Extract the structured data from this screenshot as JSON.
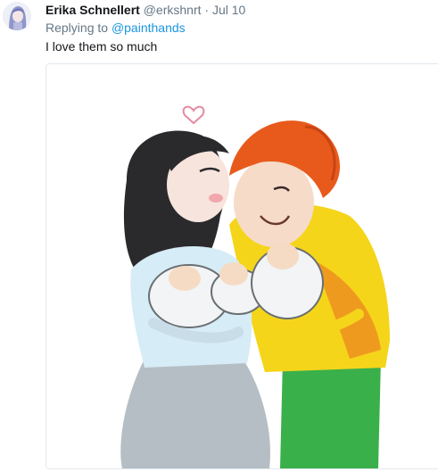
{
  "tweet": {
    "author_name": "Erika Schnellert",
    "handle": "@erkshnrt",
    "separator": "·",
    "date": "Jul 10",
    "replying_prefix": "Replying to",
    "replying_to": "@painthands",
    "text": "I love them so much"
  },
  "avatar": {
    "icon": "user-avatar-illustration"
  },
  "media": {
    "icon": "illustration-couple-with-babies"
  },
  "colors": {
    "link": "#1b95e0",
    "secondary_text": "#657786",
    "primary_text": "#14171a",
    "border": "#e1e8ed"
  }
}
